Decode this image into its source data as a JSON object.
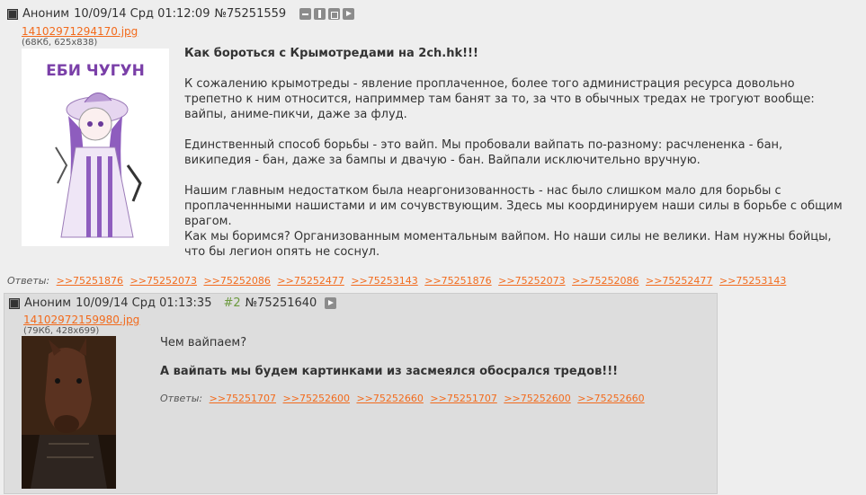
{
  "op": {
    "author": "Аноним",
    "date": "10/09/14 Срд 01:12:09",
    "number": "№75251559",
    "file": {
      "name": "14102971294170.jpg",
      "meta": "(68Кб, 625x838)",
      "thumb_caption": "ЕБИ ЧУГУН"
    },
    "title": "Как бороться с Крымотредами на 2ch.hk!!!",
    "paragraphs": [
      "К сожалению крымотреды - явление проплаченное, более того администрация ресурса довольно трепетно к ним относится, наприммер там банят за то, за что в обычных тредах не трогуют вообще: вайпы, аниме-пикчи, даже за флуд.",
      "Единственный способ борьбы - это вайп. Мы пробовали вайпать по-разному: расчлененка - бан, википедия - бан, даже за бампы и двачую - бан. Вайпали исключительно вручную.",
      "Нашим главным недостатком была неаргонизованность - нас было слишком мало для борьбы с проплаченнными нашистами и им сочувствующим. Здесь мы координируем наши силы в борьбе с общим врагом.",
      "Как мы боримся? Организованным моментальным вайпом. Но наши силы не велики. Нам нужны бойцы, что бы легион опять не соснул."
    ],
    "replies_label": "Ответы:",
    "replies": [
      ">>75251876",
      ">>75252073",
      ">>75252086",
      ">>75252477",
      ">>75253143",
      ">>75251876",
      ">>75252073",
      ">>75252086",
      ">>75252477",
      ">>75253143"
    ]
  },
  "reply": {
    "author": "Аноним",
    "date": "10/09/14 Срд 01:13:35",
    "order": "#2",
    "number": "№75251640",
    "file": {
      "name": "14102972159980.jpg",
      "meta": "(79Кб, 428x699)"
    },
    "line1": "Чем вайпаем?",
    "line2": "А вайпать мы будем картинками из засмеялся обосрался тредов!!!",
    "replies_label": "Ответы:",
    "replies": [
      ">>75251707",
      ">>75252600",
      ">>75252660",
      ">>75251707",
      ">>75252600",
      ">>75252660"
    ]
  }
}
